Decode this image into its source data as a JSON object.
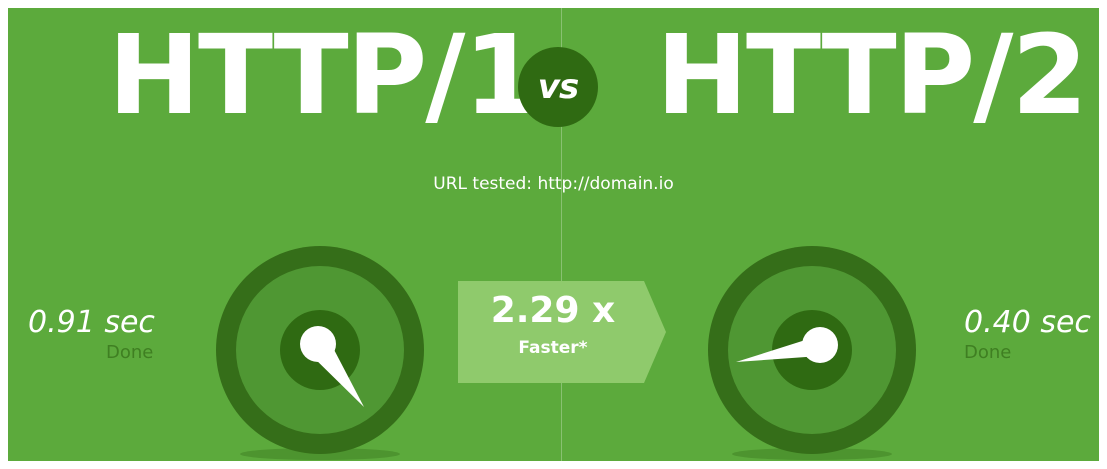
{
  "header": {
    "protocol_left": "HTTP/1",
    "vs_label": "vs",
    "protocol_right": "HTTP/2"
  },
  "test": {
    "url_line": "URL tested: http://domain.io"
  },
  "left": {
    "time": "0.91 sec",
    "status": "Done"
  },
  "right": {
    "time": "0.40 sec",
    "status": "Done"
  },
  "speedup": {
    "value": "2.29 x",
    "label": "Faster*"
  },
  "colors": {
    "background": "#5caa3c",
    "gauge_outer": "#356e19",
    "gauge_inner": "#4f9733",
    "hub": "#2f6a12",
    "speedup_box": "#8fca6c",
    "text_status": "#3f7f22"
  },
  "icons": {
    "left_gauge": "stopwatch-gauge-icon",
    "right_gauge": "stopwatch-gauge-icon",
    "speedup_arrow": "arrow-right-icon"
  }
}
